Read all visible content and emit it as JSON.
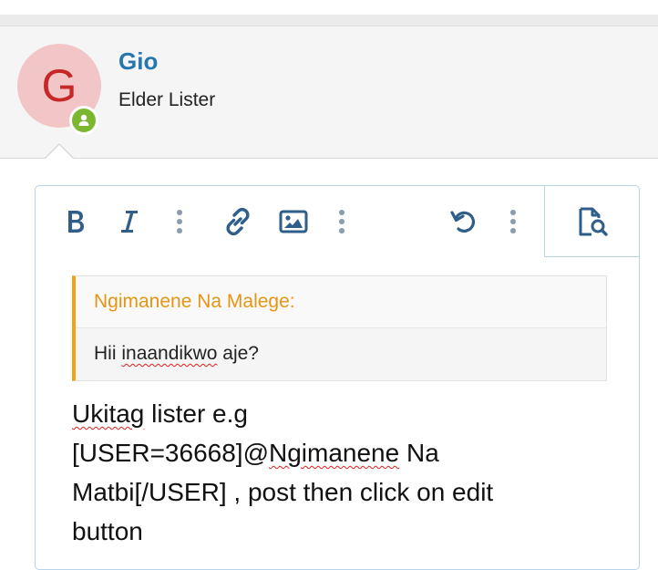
{
  "user": {
    "avatar_letter": "G",
    "name": "Gio",
    "title": "Elder Lister",
    "avatar_bg": "#f2c6c6",
    "avatar_color": "#c62828",
    "online_color": "#7cb82f"
  },
  "toolbar": {
    "buttons": [
      "bold-icon",
      "italic-icon",
      "more-options-icon",
      "link-icon",
      "image-icon",
      "more-options-icon",
      "undo-icon",
      "more-options-icon",
      "preview-icon"
    ]
  },
  "quote": {
    "author": "Ngimanene Na Malege:",
    "text_word1": "Hii",
    "text_word2": "inaandikwo",
    "text_word3": "aje?"
  },
  "message": {
    "w_ukitag": "Ukitag",
    "t1": " lister e.g",
    "t2": "[USER=36668]@",
    "w_ngimanene": "Ngimanene",
    "t3": " Na",
    "t4": "Matbi[/USER] , post then click on edit",
    "t5": "button"
  }
}
